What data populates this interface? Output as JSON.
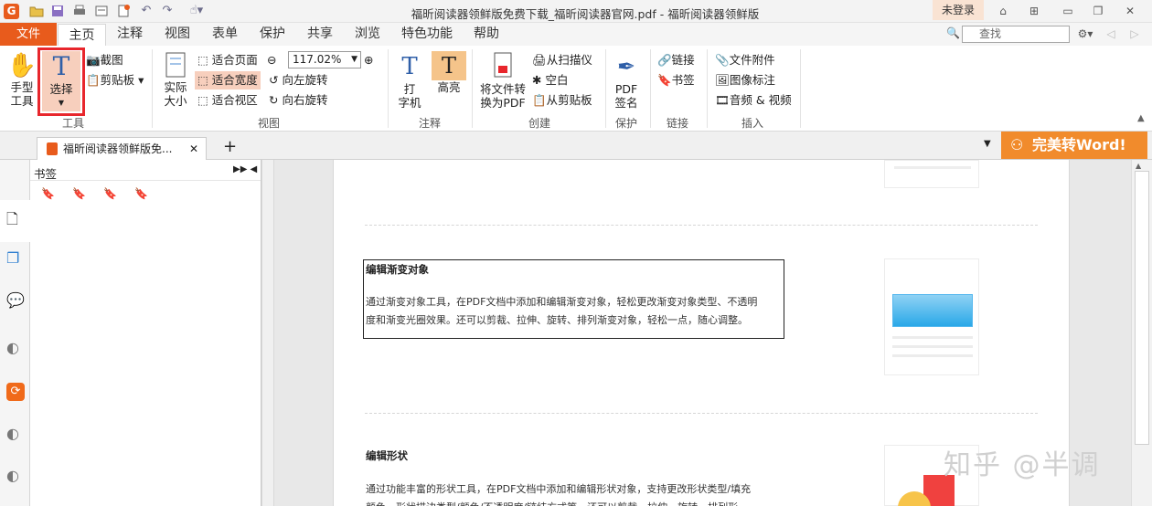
{
  "titlebar": {
    "title": "福昕阅读器领鲜版免费下载_福昕阅读器官网.pdf - 福昕阅读器领鲜版",
    "login": "未登录"
  },
  "menubar": {
    "file": "文件",
    "tabs": [
      "主页",
      "注释",
      "视图",
      "表单",
      "保护",
      "共享",
      "浏览",
      "特色功能",
      "帮助"
    ],
    "search_placeholder": "查找"
  },
  "ribbon": {
    "tools": {
      "hand": "手型\n工具",
      "select": "选择",
      "screenshot": "截图",
      "clipboard": "剪贴板",
      "group": "工具"
    },
    "view": {
      "actual": "实际\n大小",
      "fit_page": "适合页面",
      "fit_width": "适合宽度",
      "fit_visible": "适合视区",
      "zoom": "117.02%",
      "rotate_left": "向左旋转",
      "rotate_right": "向右旋转",
      "group": "视图"
    },
    "comment": {
      "typewriter": "打\n字机",
      "highlight": "高亮",
      "group": "注释"
    },
    "create": {
      "convert": "将文件转\n换为PDF",
      "scanner": "从扫描仪",
      "blank": "空白",
      "from_clipboard": "从剪贴板",
      "group": "创建"
    },
    "protect": {
      "sign": "PDF\n签名",
      "group": "保护"
    },
    "links": {
      "link": "链接",
      "bookmark": "书签",
      "group": "链接"
    },
    "insert": {
      "attachment": "文件附件",
      "image": "图像标注",
      "media": "音频 & 视频",
      "group": "插入"
    }
  },
  "tabs": {
    "doc_tab": "福昕阅读器领鲜版免...",
    "promo": "完美转Word!"
  },
  "panel": {
    "title": "书签"
  },
  "document": {
    "section1_title": "编辑渐变对象",
    "section1_line1": "通过渐变对象工具，在PDF文档中添加和编辑渐变对象，轻松更改渐变对象类型、不透明",
    "section1_line2": "度和渐变光圈效果。还可以剪裁、拉伸、旋转、排列渐变对象，轻松一点，随心调整。",
    "section2_title": "编辑形状",
    "section2_line1": "通过功能丰富的形状工具，在PDF文档中添加和编辑形状对象，支持更改形状类型/填充",
    "section2_line2": "颜色、形状描边类型/颜色/不透明度/链结方式等，还可以剪裁、拉伸、旋转、排列形"
  },
  "watermark": "知乎 @半调"
}
